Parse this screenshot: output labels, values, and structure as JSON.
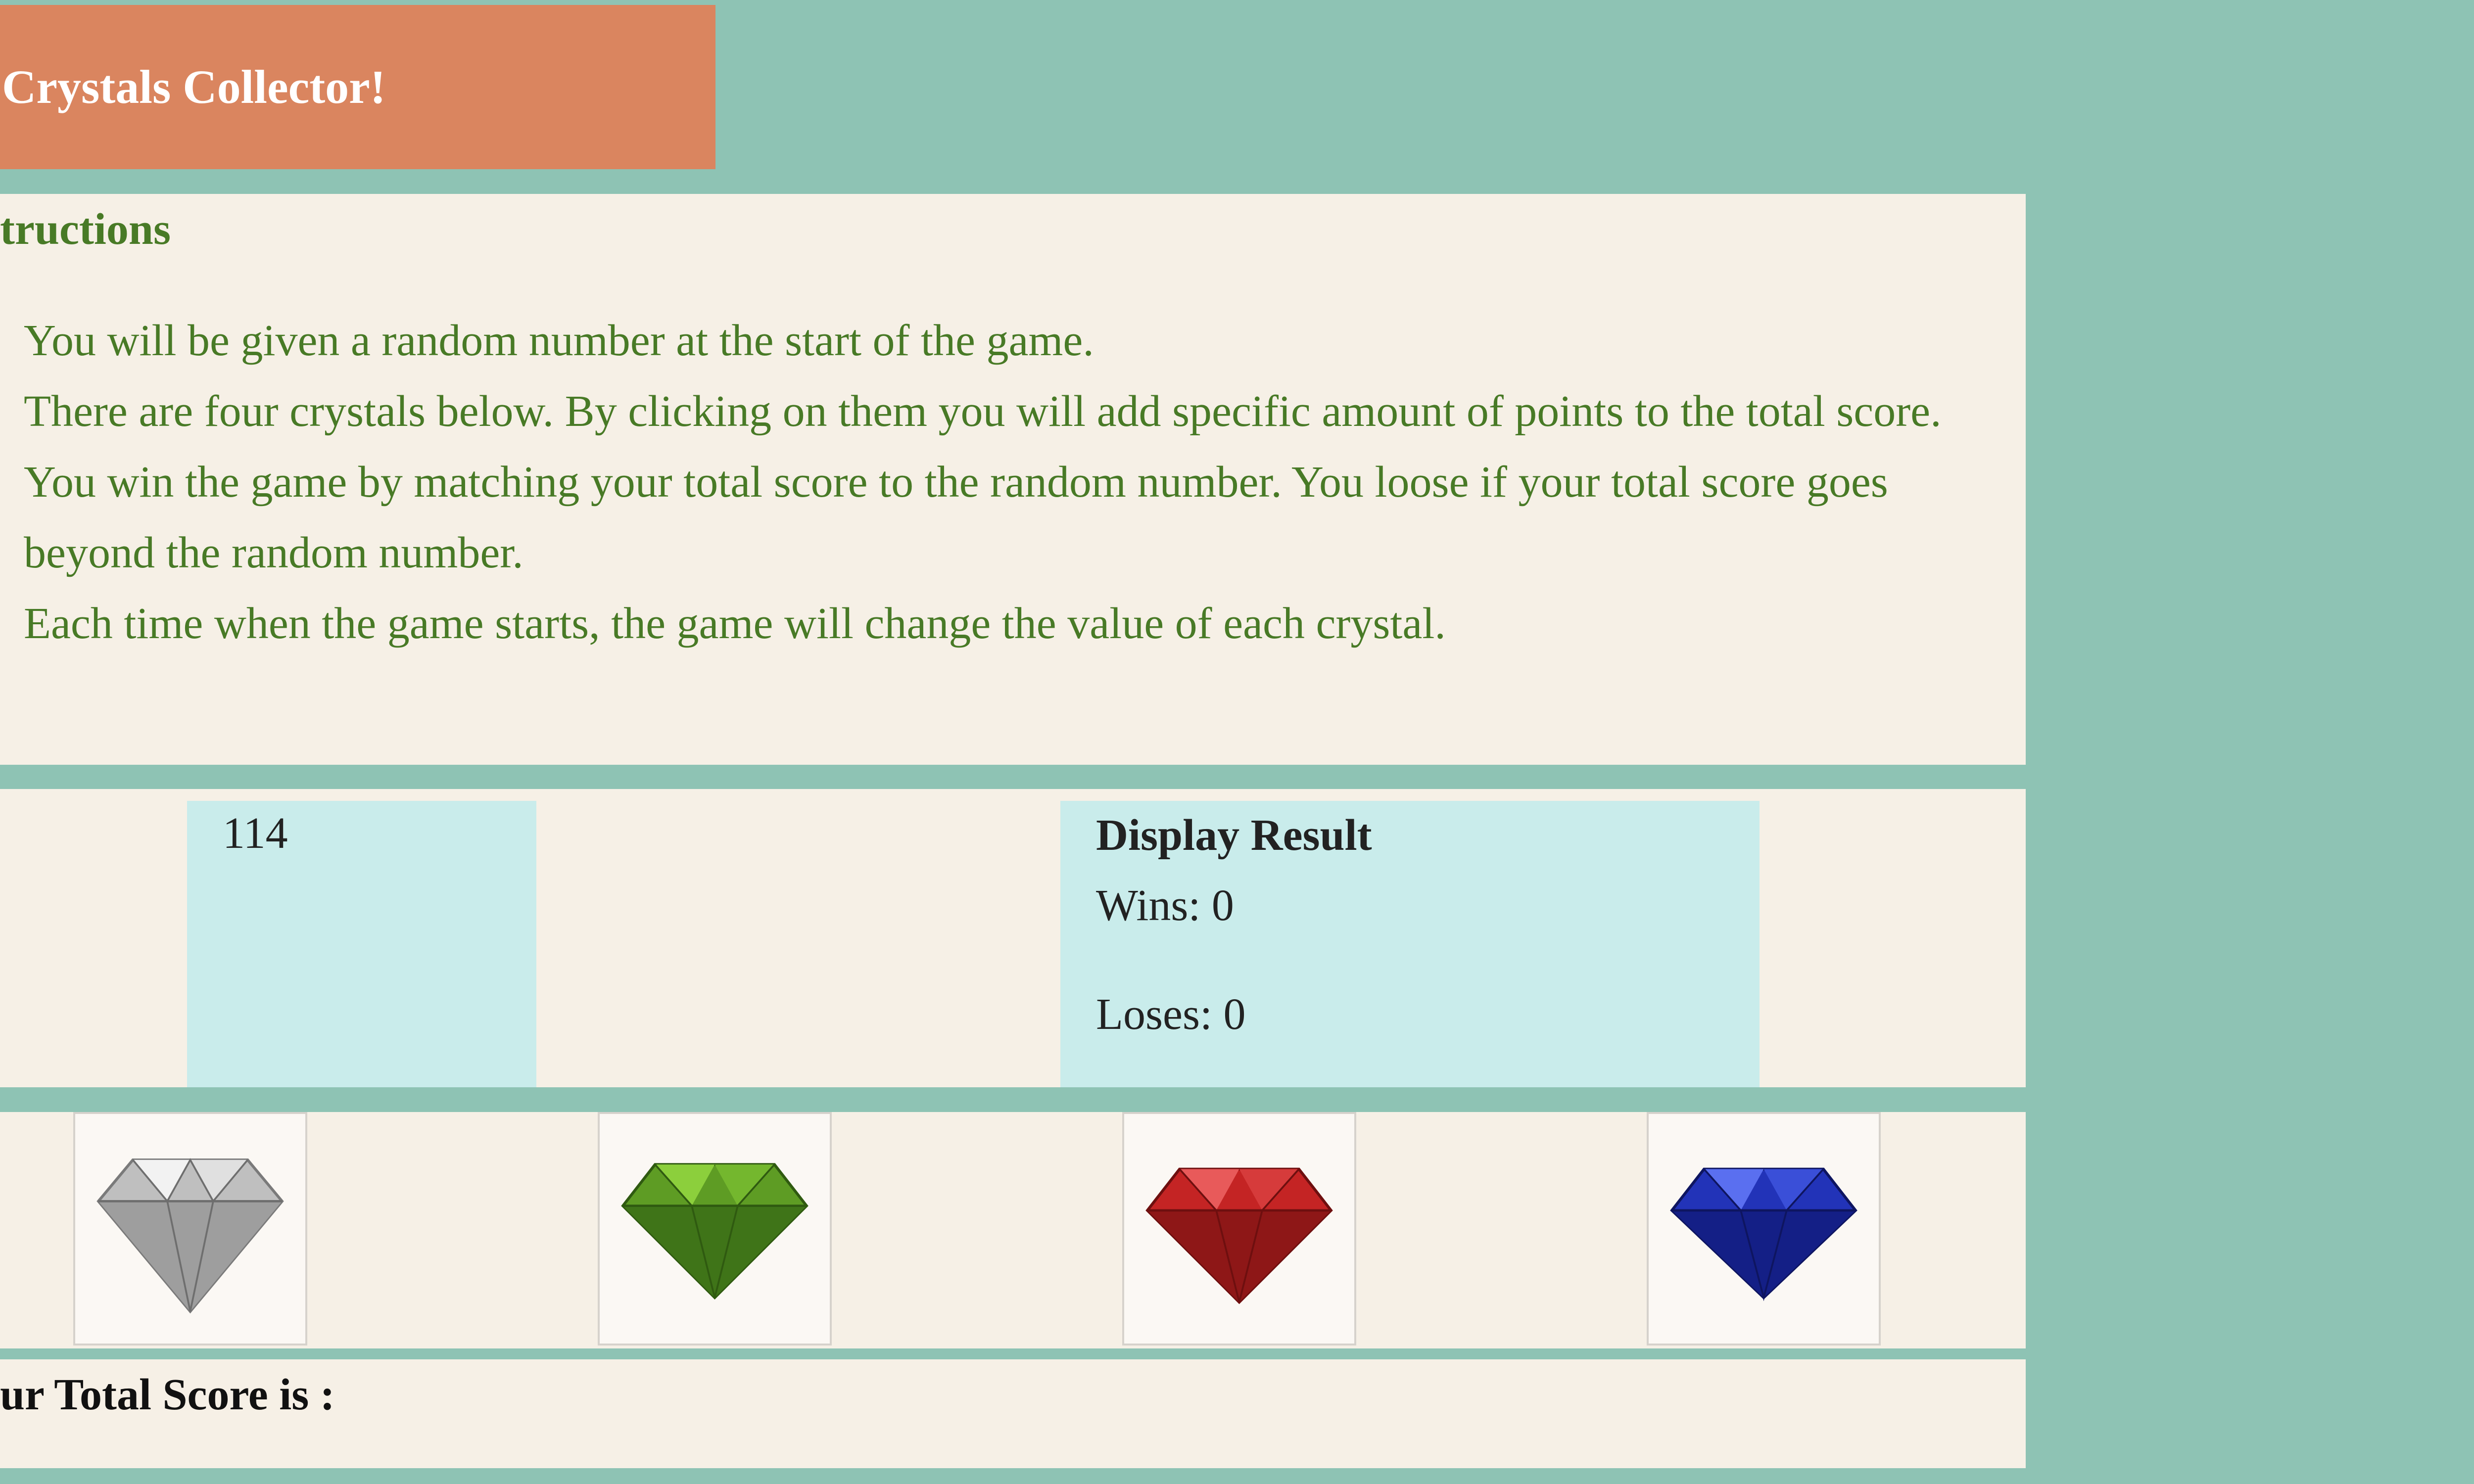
{
  "header": {
    "title": "Crystals Collector!"
  },
  "instructions": {
    "heading": "tructions",
    "lines": [
      "You will be given a random number at the start of the game.",
      "There are four crystals below. By clicking on them you will add specific amount of points to the total score.",
      "You win the game by matching your total score to the random number. You loose if your total score goes beyond the random number.",
      "Each time when the game starts, the game will change the value of each crystal."
    ]
  },
  "game": {
    "random_number": "114",
    "result": {
      "title": "Display Result",
      "wins": "Wins: 0",
      "loses": "Loses: 0"
    }
  },
  "crystals": [
    {
      "name": "diamond-icon",
      "color": "#c9c9c9"
    },
    {
      "name": "emerald-icon",
      "color": "#5e9c24"
    },
    {
      "name": "ruby-icon",
      "color": "#c42424"
    },
    {
      "name": "sapphire-icon",
      "color": "#2233b8"
    }
  ],
  "score": {
    "label": "ur Total Score is :"
  },
  "colors": {
    "background": "#8ec3b4",
    "title_bar": "#da855f",
    "panel": "#f6f0e6",
    "text_green": "#487a26",
    "info_box": "#c9eceb"
  }
}
